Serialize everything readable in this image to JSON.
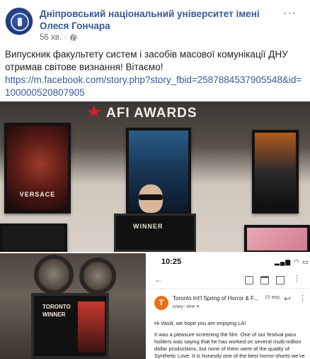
{
  "post": {
    "page_name": "Дніпровський національний університет імені Олеся Гончара",
    "time": "56 хв.",
    "dot": "·",
    "more": "···",
    "text": "Випускник факультету систем і засобів масової комунікації ДНУ отримав світове визнання! Вітаємо!",
    "link": "https://m.facebook.com/story.php?story_fbid=2587884537905548&id=100000520807905"
  },
  "photo_main": {
    "banner": "AFI AWARDS",
    "poster1_title": "VERSACE",
    "award_text": "WINNER"
  },
  "photo_left": {
    "frame_text": "TORONTO\nWINNER"
  },
  "email": {
    "status_time": "10:25",
    "status_icons": "▂▄▆ ◠ ▭",
    "sender_initial": "T",
    "sender": "Toronto Int'l Spring of Horror & F...",
    "date": "15 вер.",
    "to_line": "кому: мне ▾",
    "greeting": "Hi Vasili, we hope you are enjoying LA!",
    "body": "It was a pleasure screening the film. One of our festival pass holders was saying that he has worked on several multi-million dollar productions, but none of them were of the quality of Synthetic Love. It is honestly one of the best horror-shorts we've screened, and hope to have more of your films next year."
  },
  "colors": {
    "link": "#385898",
    "text": "#1c1e21",
    "meta": "#616770",
    "sender_avatar": "#e8711c"
  }
}
